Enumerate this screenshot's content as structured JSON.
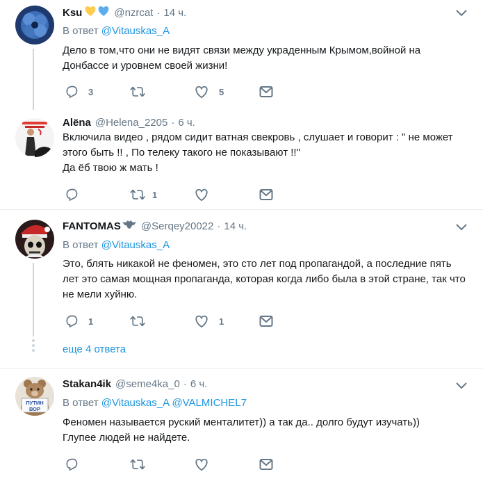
{
  "tweets": [
    {
      "name": "Ksu",
      "handle": "@nzrcat",
      "time": "14 ч.",
      "reply_prefix": "В ответ ",
      "reply_mentions": [
        "@Vitauskas_A"
      ],
      "text": "Дело в том,что они не видят связи между украденным Крымом,войной на Донбассе и уровнем своей жизни!",
      "replies": "3",
      "retweets": "",
      "likes": "5"
    },
    {
      "name": "Alёna",
      "handle": "@Helena_2205",
      "time": "6 ч.",
      "text": "Включила видео , рядом сидит ватная свекровь , слушает и говорит : \" не может этого быть !! , По телеку такого не показывают !!\"\nДа ёб твою ж мать !",
      "replies": "",
      "retweets": "1",
      "likes": ""
    },
    {
      "name": "FANTOMAS",
      "handle": "@Serqey20022",
      "time": "14 ч.",
      "reply_prefix": "В ответ ",
      "reply_mentions": [
        "@Vitauskas_A"
      ],
      "text": "Это, блять никакой не феномен, это сто лет под пропагандой, а последние пять лет это самая мощная пропаганда, которая когда либо была в этой стране, так что не мели хуйню.",
      "replies": "1",
      "retweets": "",
      "likes": "1",
      "more_replies": "еще 4 ответа"
    },
    {
      "name": "Stakan4ik",
      "handle": "@seme4ka_0",
      "time": "6 ч.",
      "reply_prefix": "В ответ ",
      "reply_mentions": [
        "@Vitauskas_A",
        "@VALMICHEL7"
      ],
      "text": "Феномен называется руский менталитет)) а так да.. долго будут изучать))\nГлупее людей не найдете.",
      "replies": "",
      "retweets": "",
      "likes": "",
      "avatar_text": "ПУТИН ВОР"
    }
  ],
  "separator": "·",
  "colors": {
    "link": "#1b95e0",
    "muted": "#657786",
    "text": "#14171a",
    "line": "#ccd6dd",
    "heart_yellow": "#ffcc4d",
    "heart_blue": "#5dadec"
  },
  "icons": [
    "reply-icon",
    "retweet-icon",
    "like-icon",
    "message-icon",
    "chevron-down-icon",
    "bat-icon"
  ]
}
